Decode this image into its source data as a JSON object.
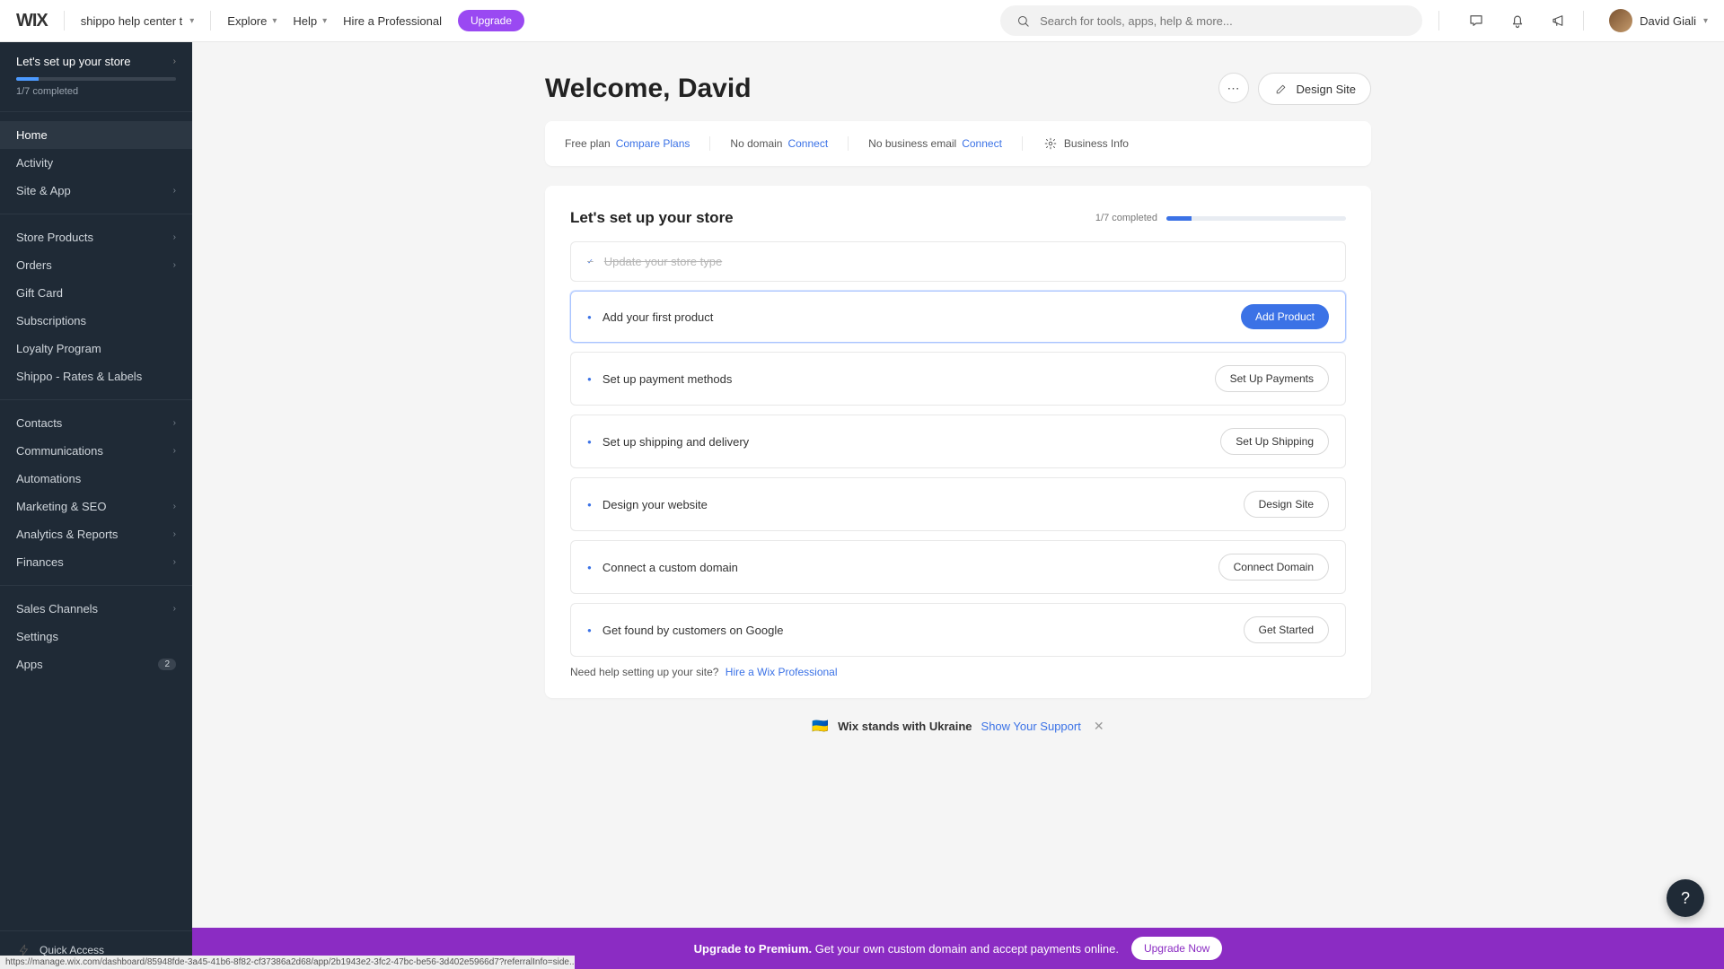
{
  "top": {
    "logo": "WIX",
    "site_name": "shippo help center t",
    "explore": "Explore",
    "help": "Help",
    "hire": "Hire a Professional",
    "upgrade": "Upgrade",
    "search_placeholder": "Search for tools, apps, help & more...",
    "user_name": "David Giali"
  },
  "sidebar": {
    "setup_title": "Let's set up your store",
    "setup_count": "1/7 completed",
    "groups": [
      [
        {
          "label": "Home",
          "active": true
        },
        {
          "label": "Activity"
        },
        {
          "label": "Site & App",
          "expand": true
        }
      ],
      [
        {
          "label": "Store Products",
          "expand": true
        },
        {
          "label": "Orders",
          "expand": true
        },
        {
          "label": "Gift Card"
        },
        {
          "label": "Subscriptions"
        },
        {
          "label": "Loyalty Program"
        },
        {
          "label": "Shippo - Rates & Labels"
        }
      ],
      [
        {
          "label": "Contacts",
          "expand": true
        },
        {
          "label": "Communications",
          "expand": true
        },
        {
          "label": "Automations"
        },
        {
          "label": "Marketing & SEO",
          "expand": true
        },
        {
          "label": "Analytics & Reports",
          "expand": true
        },
        {
          "label": "Finances",
          "expand": true
        }
      ],
      [
        {
          "label": "Sales Channels",
          "expand": true
        },
        {
          "label": "Settings"
        },
        {
          "label": "Apps",
          "badge": "2"
        }
      ]
    ],
    "quick_access": "Quick Access"
  },
  "header": {
    "welcome": "Welcome, David",
    "design_site": "Design Site"
  },
  "info": {
    "plan_label": "Free plan",
    "plan_link": "Compare Plans",
    "domain_label": "No domain",
    "domain_link": "Connect",
    "email_label": "No business email",
    "email_link": "Connect",
    "biz_info": "Business Info"
  },
  "setup": {
    "title": "Let's set up your store",
    "count": "1/7 completed",
    "tasks": [
      {
        "label": "Update your store type",
        "done": true
      },
      {
        "label": "Add your first product",
        "active": true,
        "cta": "Add Product",
        "primary": true
      },
      {
        "label": "Set up payment methods",
        "cta": "Set Up Payments"
      },
      {
        "label": "Set up shipping and delivery",
        "cta": "Set Up Shipping"
      },
      {
        "label": "Design your website",
        "cta": "Design Site"
      },
      {
        "label": "Connect a custom domain",
        "cta": "Connect Domain"
      },
      {
        "label": "Get found by customers on Google",
        "cta": "Get Started"
      }
    ],
    "help_text": "Need help setting up your site?",
    "help_link": "Hire a Wix Professional"
  },
  "ukraine": {
    "text": "Wix stands with Ukraine",
    "link": "Show Your Support"
  },
  "upsell": {
    "bold": "Upgrade to Premium.",
    "rest": "Get your own custom domain and accept payments online.",
    "cta": "Upgrade Now"
  },
  "status_url": "https://manage.wix.com/dashboard/85948fde-3a45-41b6-8f82-cf37386a2d68/app/2b1943e2-3fc2-47bc-be56-3d402e5966d7?referralInfo=side..."
}
